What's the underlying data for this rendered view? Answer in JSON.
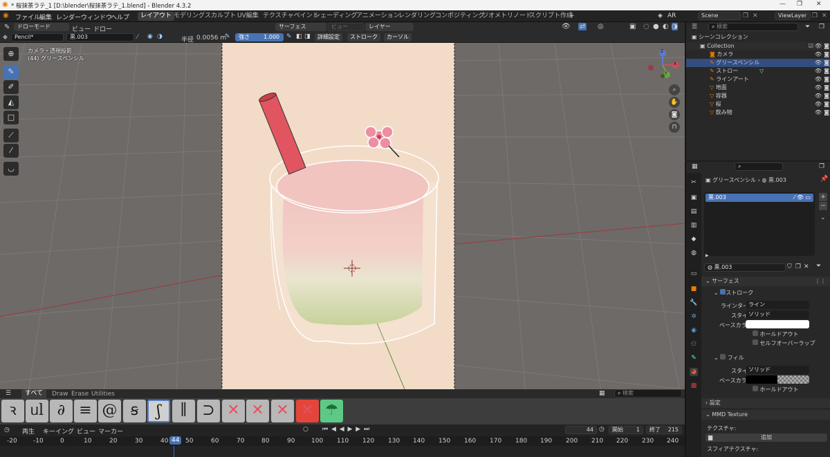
{
  "titlebar": {
    "title": "* 桜抹茶ラテ_1 [D:\\blender\\桜抹茶ラテ_1.blend] - Blender 4.3.2",
    "minimize": "—",
    "maximize": "❐",
    "close": "✕"
  },
  "menu": {
    "items": [
      "ファイル",
      "編集",
      "レンダー",
      "ウィンドウ",
      "ヘルプ"
    ]
  },
  "workspaces": [
    "レイアウト",
    "モデリング",
    "スカルプト",
    "UV編集",
    "テクスチャペイント",
    "シェーディング",
    "アニメーション",
    "レンダリング",
    "コンポジティング",
    "ジオメトリノード",
    "スクリプト作成"
  ],
  "workspace_add": "+",
  "top_right": {
    "ar": "AR",
    "scene": "Scene",
    "viewlayer": "ViewLayer"
  },
  "viewport_header": {
    "mode": "ドローモード",
    "view": "ビュー",
    "draw": "ドロー",
    "surface": "サーフェス",
    "view2": "ビュー",
    "layer": "レイヤー"
  },
  "tool_settings": {
    "brush": "Pencil*",
    "material": "黒.003",
    "radius_label": "半径",
    "radius_value": "0.0056 m",
    "strength_label": "強さ",
    "strength_value": "1.000",
    "advanced": "詳細設定",
    "stroke": "ストローク",
    "cursor": "カーソル"
  },
  "viewport_overlay": {
    "line1": "カメラ・透視投影",
    "line2": "(44) グリースペンシル"
  },
  "gizmo": {
    "x": "X",
    "y": "Y",
    "z": "Z"
  },
  "brush_tabs": {
    "all": "すべて",
    "draw": "Draw",
    "erase": "Erase",
    "utilities": "Utilities",
    "search_placeholder": "検索"
  },
  "brushes": [
    "ꝛ",
    "ᥙl",
    "∂",
    "≡",
    "@",
    "ꞩ",
    "ʃ",
    "∥",
    "⊃",
    "✕",
    "✕",
    "✕",
    "✕",
    "☂"
  ],
  "timeline": {
    "playback": "再生",
    "keying": "キーイング",
    "view": "ビュー",
    "marker": "マーカー",
    "current_frame": "44",
    "start_label": "開始",
    "start": "1",
    "end_label": "終了",
    "end": "215",
    "ruler": [
      "-20",
      "-10",
      "0",
      "10",
      "20",
      "30",
      "40",
      "44",
      "50",
      "60",
      "70",
      "80",
      "90",
      "100",
      "110",
      "120",
      "130",
      "140",
      "150",
      "160",
      "170",
      "180",
      "190",
      "200",
      "210",
      "220",
      "230",
      "240"
    ]
  },
  "outliner": {
    "search_placeholder": "検索",
    "root": "シーンコレクション",
    "collection": "Collection",
    "items": [
      "カメラ",
      "グリースペンシル",
      "ストロー",
      "ラインアート",
      "地面",
      "容器",
      "桜",
      "飲み物"
    ]
  },
  "properties": {
    "search_placeholder": "",
    "breadcrumb_obj": "グリースペンシル",
    "breadcrumb_mat": "黒.003",
    "slot": "黒.003",
    "material_name": "黒.003",
    "surface": "サーフェス",
    "stroke": "ストローク",
    "line_type_label": "ラインタイプ",
    "line_type": "ライン",
    "style_label": "スタイル",
    "style": "ソリッド",
    "base_color_label": "ベースカラー",
    "holdout": "ホールドアウト",
    "self_overlap": "セルフオーバーラップ",
    "fill": "フィル",
    "fill_style": "ソリッド",
    "fill_base_color": "ベースカラー",
    "fill_holdout": "ホールドアウト",
    "settings": "設定",
    "mmd_texture": "MMD Texture",
    "texture_label": "テクスチャ:",
    "add": "追加",
    "sphere_texture": "スフィアテクスチャ:"
  },
  "colors": {
    "accent": "#4772b3",
    "viewport_bg": "#6e6a68",
    "camera_bg": "#f2dcc8",
    "straw": "#e05560",
    "drink_top": "#f2c4bf",
    "drink_bottom": "#cfd9a6"
  }
}
